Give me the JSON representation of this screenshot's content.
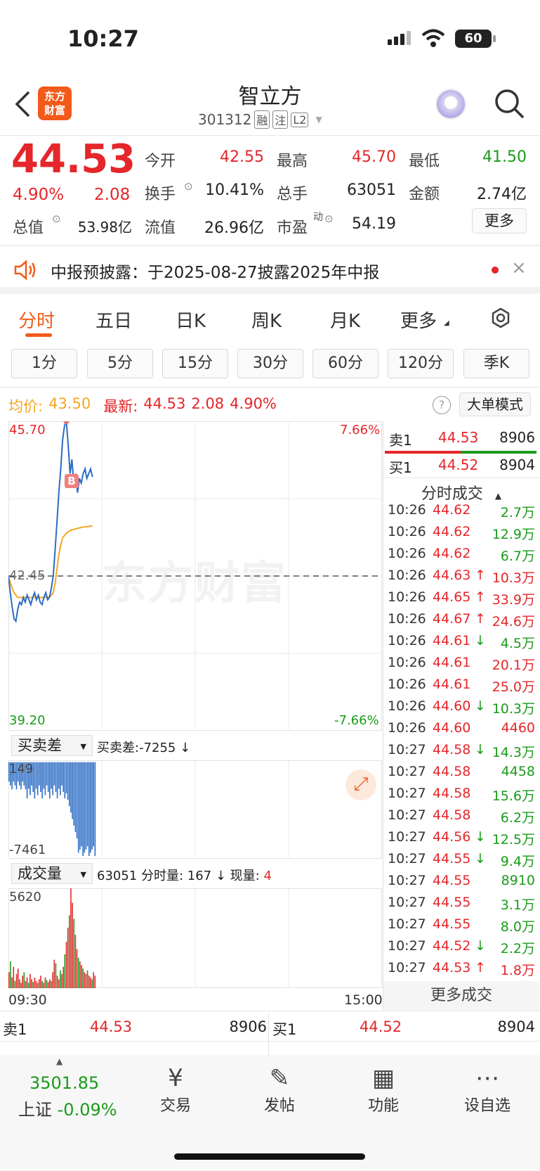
{
  "status": {
    "time": "10:27",
    "battery": "60"
  },
  "header": {
    "logo": "东方\n财富",
    "title": "智立方",
    "code": "301312",
    "tags": [
      "融",
      "注",
      "L2"
    ]
  },
  "quote": {
    "price": "44.53",
    "pct": "4.90%",
    "change": "2.08",
    "open_label": "今开",
    "open": "42.55",
    "high_label": "最高",
    "high": "45.70",
    "low_label": "最低",
    "low": "41.50",
    "turnover_label": "换手",
    "turnover": "10.41%",
    "volume_label": "总手",
    "volume": "63051",
    "amount_label": "金额",
    "amount": "2.74亿",
    "mktcap_label": "总值",
    "mktcap": "53.98亿",
    "float_label": "流值",
    "float": "26.96亿",
    "pe_label": "市盈",
    "pe_sup": "动",
    "pe": "54.19",
    "more": "更多"
  },
  "notice": {
    "text": "中报预披露：于2025-08-27披露2025年中报"
  },
  "tabs": [
    "分时",
    "五日",
    "日K",
    "周K",
    "月K",
    "更多"
  ],
  "ktabs": [
    "1分",
    "5分",
    "15分",
    "30分",
    "60分",
    "120分",
    "季K"
  ],
  "chart_info": {
    "avg_label": "均价:",
    "avg": "43.50",
    "last_label": "最新:",
    "last": "44.53",
    "chg": "2.08",
    "pct": "4.90%",
    "mode": "大单模式"
  },
  "chart_labels": {
    "top": "45.70",
    "mid": "42.45",
    "bottom": "39.20",
    "top_pct": "7.66%",
    "bottom_pct": "-7.66%",
    "start_time": "09:30",
    "end_time": "15:00"
  },
  "sub1": {
    "selector": "买卖差",
    "text": "买卖差:-7255 ↓",
    "max": "149",
    "min": "-7461"
  },
  "sub2": {
    "selector": "成交量",
    "text_a": "63051 分时量: 167 ↓ 现量: ",
    "text_b": "4",
    "max": "5620"
  },
  "orderbook": {
    "sell_label": "卖1",
    "sell_price": "44.53",
    "sell_vol": "8906",
    "buy_label": "买1",
    "buy_price": "44.52",
    "buy_vol": "8904"
  },
  "trades_title": "分时成交",
  "trades": [
    {
      "t": "10:26",
      "p": "44.62",
      "a": "",
      "v": "2.7万",
      "c": "green"
    },
    {
      "t": "10:26",
      "p": "44.62",
      "a": "",
      "v": "12.9万",
      "c": "green"
    },
    {
      "t": "10:26",
      "p": "44.62",
      "a": "",
      "v": "6.7万",
      "c": "green"
    },
    {
      "t": "10:26",
      "p": "44.63",
      "a": "↑",
      "v": "10.3万",
      "c": "red"
    },
    {
      "t": "10:26",
      "p": "44.65",
      "a": "↑",
      "v": "33.9万",
      "c": "red"
    },
    {
      "t": "10:26",
      "p": "44.67",
      "a": "↑",
      "v": "24.6万",
      "c": "red"
    },
    {
      "t": "10:26",
      "p": "44.61",
      "a": "↓",
      "v": "4.5万",
      "c": "green"
    },
    {
      "t": "10:26",
      "p": "44.61",
      "a": "",
      "v": "20.1万",
      "c": "red"
    },
    {
      "t": "10:26",
      "p": "44.61",
      "a": "",
      "v": "25.0万",
      "c": "red"
    },
    {
      "t": "10:26",
      "p": "44.60",
      "a": "↓",
      "v": "10.3万",
      "c": "green"
    },
    {
      "t": "10:26",
      "p": "44.60",
      "a": "",
      "v": "4460",
      "c": "red"
    },
    {
      "t": "10:27",
      "p": "44.58",
      "a": "↓",
      "v": "14.3万",
      "c": "green"
    },
    {
      "t": "10:27",
      "p": "44.58",
      "a": "",
      "v": "4458",
      "c": "green"
    },
    {
      "t": "10:27",
      "p": "44.58",
      "a": "",
      "v": "15.6万",
      "c": "green"
    },
    {
      "t": "10:27",
      "p": "44.58",
      "a": "",
      "v": "6.2万",
      "c": "green"
    },
    {
      "t": "10:27",
      "p": "44.56",
      "a": "↓",
      "v": "12.5万",
      "c": "green"
    },
    {
      "t": "10:27",
      "p": "44.55",
      "a": "↓",
      "v": "9.4万",
      "c": "green"
    },
    {
      "t": "10:27",
      "p": "44.55",
      "a": "",
      "v": "8910",
      "c": "green"
    },
    {
      "t": "10:27",
      "p": "44.55",
      "a": "",
      "v": "3.1万",
      "c": "green"
    },
    {
      "t": "10:27",
      "p": "44.55",
      "a": "",
      "v": "8.0万",
      "c": "green"
    },
    {
      "t": "10:27",
      "p": "44.52",
      "a": "↓",
      "v": "2.2万",
      "c": "green"
    },
    {
      "t": "10:27",
      "p": "44.53",
      "a": "↑",
      "v": "1.8万",
      "c": "red"
    }
  ],
  "more_trades": "更多成交",
  "bottom_book": {
    "sell_label": "卖1",
    "sell_price": "44.53",
    "sell_vol": "8906",
    "buy_label": "买1",
    "buy_price": "44.52",
    "buy_vol": "8904"
  },
  "index": {
    "value": "3501.85",
    "name": "上证",
    "pct": "-0.09%"
  },
  "nav": [
    {
      "label": "交易",
      "icon": "trade-icon"
    },
    {
      "label": "发帖",
      "icon": "post-icon"
    },
    {
      "label": "功能",
      "icon": "apps-icon"
    },
    {
      "label": "设自选",
      "icon": "more-dots-icon"
    }
  ],
  "watermark": "东方财富",
  "colors": {
    "up": "#e5262a",
    "down": "#1a9b1a",
    "price_line": "#2b6cc4",
    "avg_line": "#f5a623",
    "brand": "#f25a1a"
  }
}
